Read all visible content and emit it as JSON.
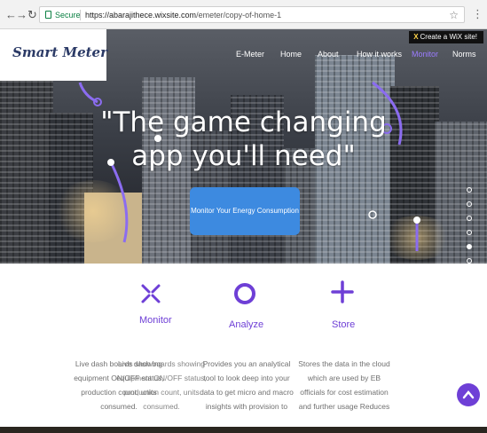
{
  "browser": {
    "secure_label": "Secure",
    "url_host": "https://abarajithece.wixsite.com",
    "url_path": "/emeter/copy-of-home-1"
  },
  "header": {
    "logo_text": "Smart Meter",
    "menu": [
      {
        "label": "E-Meter",
        "active": false
      },
      {
        "label": "Home",
        "active": false
      },
      {
        "label": "About",
        "active": false
      },
      {
        "label": "How it works",
        "active": false
      },
      {
        "label": "Monitor",
        "active": true
      },
      {
        "label": "Norms",
        "active": false
      }
    ],
    "wix_badge": "Create a WiX site!"
  },
  "hero": {
    "title_line1": "\"The game changing",
    "title_line2": "app you'll need\"",
    "cta_label": "Monitor Your Energy Consumption",
    "slide_count": 6,
    "active_slide": 5
  },
  "features": [
    {
      "title": "Monitor",
      "icon": "arrows-in-icon",
      "desc": [
        "Live dash boards showing",
        "equipment ON/OFF status,",
        "production count, units",
        "consumed."
      ],
      "desc_overlay": [
        "Live dash boards showing",
        "equipment ON/OFF status,",
        "production count, units",
        "consumed."
      ]
    },
    {
      "title": "Analyze",
      "icon": "ring-icon",
      "desc": [
        "Provides you an analytical",
        "tool to look deep into your",
        "data to get micro and macro",
        "insights with  provision to"
      ]
    },
    {
      "title": "Store",
      "icon": "plus-icon",
      "desc": [
        "Stores the data in the cloud",
        "which are used by EB",
        "officials for cost estimation",
        "and further usage Reduces"
      ]
    }
  ],
  "colors": {
    "accent": "#6e3fd6",
    "cta": "#3d8ae0",
    "logo": "#2b3a66"
  }
}
